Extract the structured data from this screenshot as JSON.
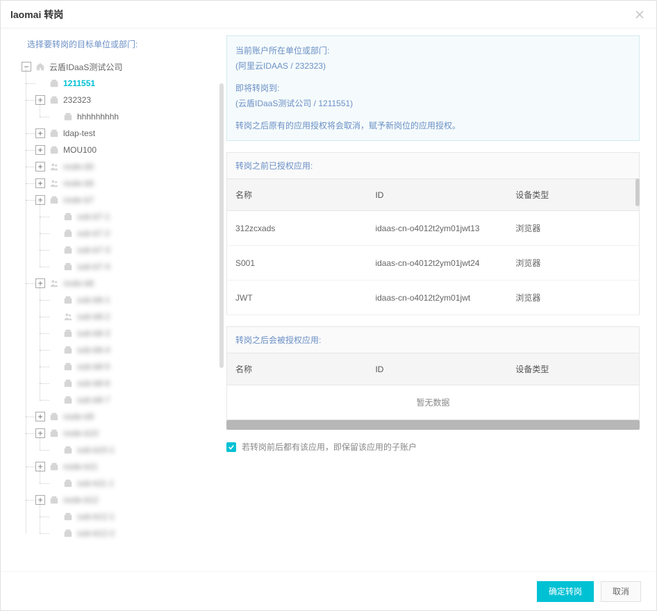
{
  "header": {
    "title": "laomai 转岗"
  },
  "left": {
    "instruction": "选择要转岗的目标单位或部门:"
  },
  "tree": {
    "root": {
      "label": "云盾IDaaS测试公司",
      "children": [
        {
          "label": "1211551",
          "icon": "folder",
          "exp": "none",
          "selected": true
        },
        {
          "label": "232323",
          "icon": "folder",
          "exp": "plus",
          "children": [
            {
              "label": "hhhhhhhhh",
              "icon": "folder",
              "exp": "none"
            }
          ]
        },
        {
          "label": "ldap-test",
          "icon": "folder",
          "exp": "plus"
        },
        {
          "label": "MOU100",
          "icon": "folder",
          "exp": "plus"
        },
        {
          "label": "node-b5",
          "icon": "people",
          "exp": "plus",
          "blur": true
        },
        {
          "label": "node-b6",
          "icon": "people",
          "exp": "plus",
          "blur": true
        },
        {
          "label": "node-b7",
          "icon": "folder",
          "exp": "plus",
          "blur": true,
          "children": [
            {
              "label": "sub-b7-1",
              "icon": "folder",
              "exp": "none",
              "blur": true
            },
            {
              "label": "sub-b7-2",
              "icon": "folder",
              "exp": "none",
              "blur": true
            },
            {
              "label": "sub-b7-3",
              "icon": "folder",
              "exp": "none",
              "blur": true
            },
            {
              "label": "sub-b7-4",
              "icon": "folder",
              "exp": "none",
              "blur": true
            }
          ]
        },
        {
          "label": "node-b8",
          "icon": "people",
          "exp": "plus",
          "blur": true,
          "children": [
            {
              "label": "sub-b8-1",
              "icon": "folder",
              "exp": "none",
              "blur": true
            },
            {
              "label": "sub-b8-2",
              "icon": "people",
              "exp": "none",
              "blur": true
            },
            {
              "label": "sub-b8-3",
              "icon": "folder",
              "exp": "none",
              "blur": true
            },
            {
              "label": "sub-b8-4",
              "icon": "folder",
              "exp": "none",
              "blur": true
            },
            {
              "label": "sub-b8-5",
              "icon": "folder",
              "exp": "none",
              "blur": true
            },
            {
              "label": "sub-b8-6",
              "icon": "folder",
              "exp": "none",
              "blur": true
            },
            {
              "label": "sub-b8-7",
              "icon": "folder",
              "exp": "none",
              "blur": true
            }
          ]
        },
        {
          "label": "node-b9",
          "icon": "folder",
          "exp": "plus",
          "blur": true
        },
        {
          "label": "node-b10",
          "icon": "folder",
          "exp": "plus",
          "blur": true,
          "children": [
            {
              "label": "sub-b10-1",
              "icon": "folder",
              "exp": "none",
              "blur": true
            }
          ]
        },
        {
          "label": "node-b11",
          "icon": "folder",
          "exp": "plus",
          "blur": true,
          "children": [
            {
              "label": "sub-b11-1",
              "icon": "folder",
              "exp": "none",
              "blur": true
            }
          ]
        },
        {
          "label": "node-b12",
          "icon": "folder",
          "exp": "plus",
          "blur": true,
          "children": [
            {
              "label": "sub-b12-1",
              "icon": "folder",
              "exp": "none",
              "blur": true
            },
            {
              "label": "sub-b12-2",
              "icon": "folder",
              "exp": "none",
              "blur": true
            }
          ]
        }
      ]
    }
  },
  "info": {
    "line1": "当前账户所在单位或部门:",
    "line2": "(阿里云IDAAS / 232323)",
    "line3": "即将转岗到:",
    "line4": "(云盾IDaaS测试公司 / 1211551)",
    "line5": "转岗之后原有的应用授权将会取消，赋予新岗位的应用授权。"
  },
  "table1": {
    "header": "转岗之前已授权应用:",
    "columns": [
      "名称",
      "ID",
      "设备类型"
    ],
    "rows": [
      {
        "name": "312zcxads",
        "id": "idaas-cn-o4012t2ym01jwt13",
        "type": "浏览器"
      },
      {
        "name": "S001",
        "id": "idaas-cn-o4012t2ym01jwt24",
        "type": "浏览器"
      },
      {
        "name": "JWT",
        "id": "idaas-cn-o4012t2ym01jwt",
        "type": "浏览器"
      }
    ]
  },
  "table2": {
    "header": "转岗之后会被授权应用:",
    "columns": [
      "名称",
      "ID",
      "设备类型"
    ],
    "empty": "暂无数据"
  },
  "checkbox": {
    "label": "若转岗前后都有该应用，即保留该应用的子账户",
    "checked": true
  },
  "footer": {
    "confirm": "确定转岗",
    "cancel": "取消"
  },
  "colors": {
    "accent": "#00c1d4"
  }
}
